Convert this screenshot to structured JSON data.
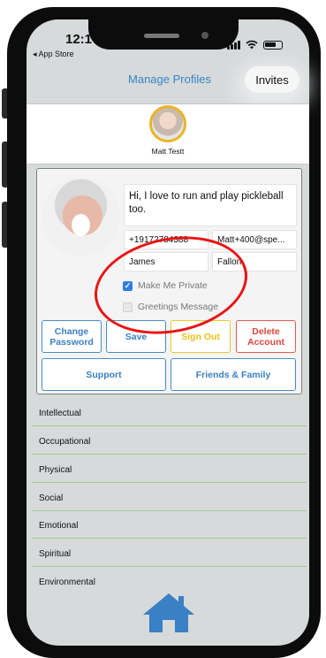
{
  "status": {
    "time": "12:1",
    "back_label": "◂ App Store"
  },
  "header": {
    "title": "Manage Profiles",
    "invites_label": "Invites"
  },
  "profile_strip": {
    "name": "Matt Testt"
  },
  "profile": {
    "bio": "Hi, I love to run and play pickleball too.",
    "phone": "+19172784388",
    "email": "Matt+400@spe...",
    "first_name": "James",
    "last_name": "Fallon"
  },
  "checkboxes": [
    {
      "label": "Make Me Private",
      "checked": true
    },
    {
      "label": "Greetings Message",
      "checked": false
    }
  ],
  "buttons": {
    "change_password": "Change Password",
    "save": "Save",
    "sign_out": "Sign Out",
    "delete_account": "Delete Account",
    "support": "Support",
    "friends_family": "Friends & Family"
  },
  "categories": [
    "Intellectual",
    "Occupational",
    "Physical",
    "Social",
    "Emotional",
    "Spiritual",
    "Environmental"
  ],
  "colors": {
    "accent_blue": "#3b7fc4",
    "warning_yellow": "#e6c21c",
    "danger_red": "#e0433f",
    "annotation_red": "#e81414",
    "divider_green": "#9ccd8e"
  },
  "icons": {
    "home": "home-icon"
  }
}
